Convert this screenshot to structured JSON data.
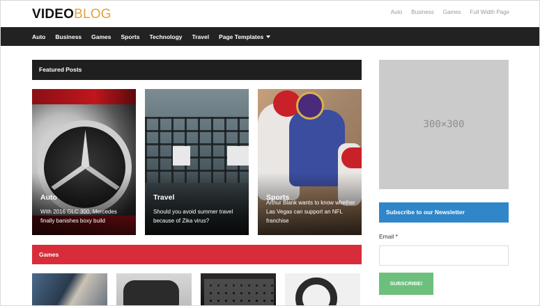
{
  "header": {
    "logo_part1": "VIDEO",
    "logo_part2": "BLOG",
    "top_links": [
      "Auto",
      "Business",
      "Games",
      "Full Width Page"
    ]
  },
  "nav": {
    "items": [
      "Auto",
      "Business",
      "Games",
      "Sports",
      "Technology",
      "Travel",
      "Page Templates"
    ]
  },
  "featured": {
    "title": "Featured Posts",
    "cards": [
      {
        "category": "Auto",
        "title": "With 2016 GLC 300, Mercedes finally banishes boxy build"
      },
      {
        "category": "Travel",
        "title": "Should you avoid summer travel because of Zika virus?"
      },
      {
        "category": "Sports",
        "title": "Arthur Blank wants to know whether Las Vegas can support an NFL franchise"
      }
    ]
  },
  "games": {
    "title": "Games"
  },
  "sidebar": {
    "ad_text": "300×300",
    "newsletter_title": "Subscribe to our Newsletter",
    "email_label": "Email *",
    "email_value": "",
    "subscribe_label": "SUBSCRIBE!"
  },
  "colors": {
    "nav_bg": "#222222",
    "logo_accent": "#e3a23a",
    "games_red": "#d82c3a",
    "newsletter_blue": "#2f86c8",
    "subscribe_green": "#6cc07c",
    "ad_grey": "#cbcbcb"
  }
}
